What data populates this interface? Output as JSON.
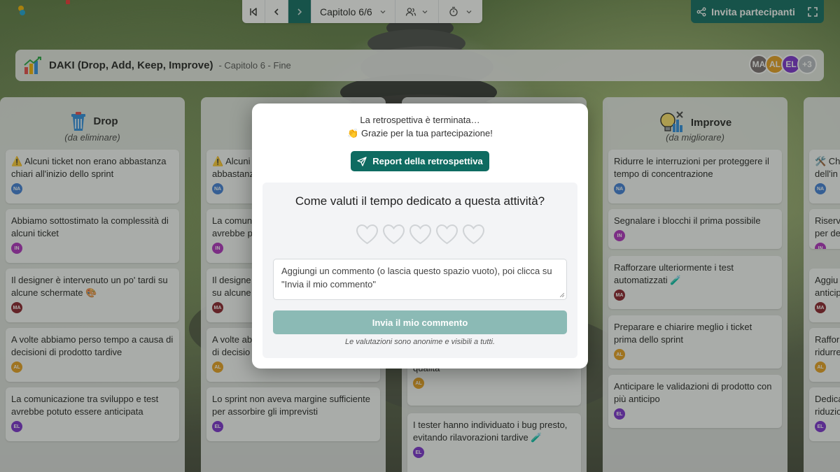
{
  "toolbar": {
    "chapter_label": "Capitolo 6/6",
    "invite_label": "Invita partecipanti"
  },
  "title_bar": {
    "title": "DAKI (Drop, Add, Keep, Improve)",
    "subtitle": "- Capitolo 6 - Fine",
    "avatars": [
      {
        "initials": "MA",
        "color": "#7a6e70"
      },
      {
        "initials": "AL",
        "color": "#e8a020"
      },
      {
        "initials": "EL",
        "color": "#7b2fd0"
      },
      {
        "initials": "+3",
        "color": "#b9bcc4"
      }
    ]
  },
  "columns": [
    {
      "title": "Drop",
      "subtitle": "(da eliminare)",
      "icon": "trash-icon",
      "tickets": [
        {
          "text": "⚠️ Alcuni ticket non erano abbastanza chiari all'inizio dello sprint",
          "author": "NA",
          "color": "#3f7fd9"
        },
        {
          "text": "Abbiamo sottostimato la complessità di alcuni ticket",
          "author": "IN",
          "color": "#b02fc0"
        },
        {
          "text": "Il designer è intervenuto un po' tardi su alcune schermate 🎨",
          "author": "MA",
          "color": "#8a1f2a"
        },
        {
          "text": "A volte abbiamo perso tempo a causa di decisioni di prodotto tardive",
          "author": "AL",
          "color": "#e8a020"
        },
        {
          "text": "La comunicazione tra sviluppo e test avrebbe potuto essere anticipata",
          "author": "EL",
          "color": "#7b2fd0"
        }
      ]
    },
    {
      "title": "",
      "subtitle": "",
      "tickets": [
        {
          "text": "⚠️ Alcuni",
          "text2": "abbastanz",
          "author": "NA",
          "color": "#3f7fd9"
        },
        {
          "text": "La comun",
          "text2": "avrebbe p",
          "author": "IN",
          "color": "#b02fc0"
        },
        {
          "text": "Il designe",
          "text2": "su alcune",
          "author": "MA",
          "color": "#8a1f2a"
        },
        {
          "text": "A volte ab",
          "text2": "di decisio",
          "author": "AL",
          "color": "#e8a020"
        },
        {
          "text": "Lo sprint non aveva margine sufficiente per assorbire gli imprevisti",
          "author": "EL",
          "color": "#7b2fd0"
        }
      ]
    },
    {
      "title": "",
      "subtitle": "",
      "tickets": [
        {
          "text": "lavoro pulito con grande attenzione alla qualità",
          "author": "AL",
          "color": "#e8a020"
        },
        {
          "text": "I tester hanno individuato i bug presto, evitando rilavorazioni tardive 🧪",
          "author": "EL",
          "color": "#7b2fd0"
        }
      ]
    },
    {
      "title": "Improve",
      "subtitle": "(da migliorare)",
      "icon": "tools-icon",
      "tickets": [
        {
          "text": "Ridurre le interruzioni per proteggere il tempo di concentrazione",
          "author": "NA",
          "color": "#3f7fd9"
        },
        {
          "text": "Segnalare i blocchi il prima possibile",
          "author": "IN",
          "color": "#b02fc0"
        },
        {
          "text": "Rafforzare ulteriormente i test automatizzati 🧪",
          "author": "MA",
          "color": "#8a1f2a"
        },
        {
          "text": "Preparare e chiarire meglio i ticket prima dello sprint",
          "author": "AL",
          "color": "#e8a020"
        },
        {
          "text": "Anticipare le validazioni di prodotto con più anticipo",
          "author": "EL",
          "color": "#7b2fd0"
        }
      ]
    },
    {
      "title": "",
      "subtitle": "",
      "tickets": [
        {
          "text": "🛠️ Ch",
          "text2": "dell'in",
          "author": "NA",
          "color": "#3f7fd9"
        },
        {
          "text": "Riserv",
          "text2": "per de",
          "author": "IN",
          "color": "#b02fc0"
        },
        {
          "text": "Aggiu",
          "text2": "anticip",
          "author": "MA",
          "color": "#8a1f2a"
        },
        {
          "text": "Raffor",
          "text2": "ridurre",
          "author": "AL",
          "color": "#e8a020"
        },
        {
          "text": "Dedica",
          "text2": "riduzio",
          "author": "EL",
          "color": "#7b2fd0"
        }
      ]
    }
  ],
  "modal": {
    "line1": "La retrospettiva è terminata…",
    "line2": "👏 Grazie per la tua partecipazione!",
    "report_button": "Report della retrospettiva",
    "question": "Come valuti il tempo dedicato a questa attività?",
    "rating": 0,
    "rating_max": 5,
    "comment_placeholder": "Aggiungi un commento (o lascia questo spazio vuoto), poi clicca su \"Invia il mio commento\"",
    "submit_label": "Invia il mio commento",
    "note": "Le valutazioni sono anonime e visibili a tutti."
  }
}
